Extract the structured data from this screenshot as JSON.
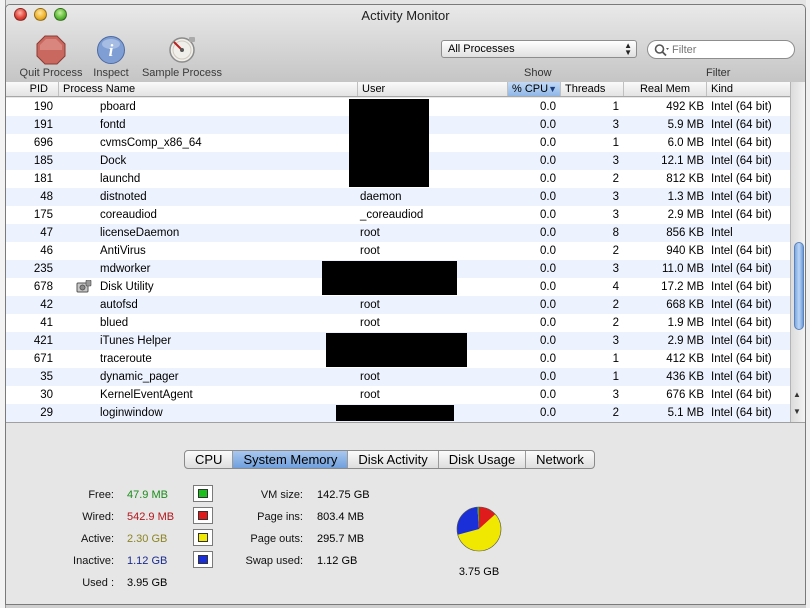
{
  "window": {
    "title": "Activity Monitor"
  },
  "toolbar": {
    "quit_label": "Quit Process",
    "inspect_label": "Inspect",
    "sample_label": "Sample Process",
    "show_value": "All Processes",
    "show_label": "Show",
    "filter_placeholder": "Filter",
    "filter_label": "Filter"
  },
  "table": {
    "columns": {
      "pid": "PID",
      "name": "Process Name",
      "user": "User",
      "cpu": "% CPU",
      "threads": "Threads",
      "mem": "Real Mem",
      "kind": "Kind"
    },
    "rows": [
      {
        "pid": "190",
        "name": "pboard",
        "user": "",
        "cpu": "0.0",
        "threads": "1",
        "mem": "492 KB",
        "kind": "Intel (64 bit)"
      },
      {
        "pid": "191",
        "name": "fontd",
        "user": "",
        "cpu": "0.0",
        "threads": "3",
        "mem": "5.9 MB",
        "kind": "Intel (64 bit)"
      },
      {
        "pid": "696",
        "name": "cvmsComp_x86_64",
        "user": "",
        "cpu": "0.0",
        "threads": "1",
        "mem": "6.0 MB",
        "kind": "Intel (64 bit)"
      },
      {
        "pid": "185",
        "name": "Dock",
        "user": "",
        "cpu": "0.0",
        "threads": "3",
        "mem": "12.1 MB",
        "kind": "Intel (64 bit)"
      },
      {
        "pid": "181",
        "name": "launchd",
        "user": "",
        "cpu": "0.0",
        "threads": "2",
        "mem": "812 KB",
        "kind": "Intel (64 bit)"
      },
      {
        "pid": "48",
        "name": "distnoted",
        "user": "daemon",
        "cpu": "0.0",
        "threads": "3",
        "mem": "1.3 MB",
        "kind": "Intel (64 bit)"
      },
      {
        "pid": "175",
        "name": "coreaudiod",
        "user": "_coreaudiod",
        "cpu": "0.0",
        "threads": "3",
        "mem": "2.9 MB",
        "kind": "Intel (64 bit)"
      },
      {
        "pid": "47",
        "name": "licenseDaemon",
        "user": "root",
        "cpu": "0.0",
        "threads": "8",
        "mem": "856 KB",
        "kind": "Intel"
      },
      {
        "pid": "46",
        "name": "AntiVirus",
        "user": "root",
        "cpu": "0.0",
        "threads": "2",
        "mem": "940 KB",
        "kind": "Intel (64 bit)"
      },
      {
        "pid": "235",
        "name": "mdworker",
        "user": "",
        "cpu": "0.0",
        "threads": "3",
        "mem": "11.0 MB",
        "kind": "Intel (64 bit)"
      },
      {
        "pid": "678",
        "name": "Disk Utility",
        "user": "",
        "cpu": "0.0",
        "threads": "4",
        "mem": "17.2 MB",
        "kind": "Intel (64 bit)",
        "icon": "disk-utility-icon"
      },
      {
        "pid": "42",
        "name": "autofsd",
        "user": "root",
        "cpu": "0.0",
        "threads": "2",
        "mem": "668 KB",
        "kind": "Intel (64 bit)"
      },
      {
        "pid": "41",
        "name": "blued",
        "user": "root",
        "cpu": "0.0",
        "threads": "2",
        "mem": "1.9 MB",
        "kind": "Intel (64 bit)"
      },
      {
        "pid": "421",
        "name": "iTunes Helper",
        "user": "",
        "cpu": "0.0",
        "threads": "3",
        "mem": "2.9 MB",
        "kind": "Intel (64 bit)"
      },
      {
        "pid": "671",
        "name": "traceroute",
        "user": "",
        "cpu": "0.0",
        "threads": "1",
        "mem": "412 KB",
        "kind": "Intel (64 bit)"
      },
      {
        "pid": "35",
        "name": "dynamic_pager",
        "user": "root",
        "cpu": "0.0",
        "threads": "1",
        "mem": "436 KB",
        "kind": "Intel (64 bit)"
      },
      {
        "pid": "30",
        "name": "KernelEventAgent",
        "user": "root",
        "cpu": "0.0",
        "threads": "3",
        "mem": "676 KB",
        "kind": "Intel (64 bit)"
      },
      {
        "pid": "29",
        "name": "loginwindow",
        "user": "",
        "cpu": "0.0",
        "threads": "2",
        "mem": "5.1 MB",
        "kind": "Intel (64 bit)"
      }
    ]
  },
  "tabs": [
    "CPU",
    "System Memory",
    "Disk Activity",
    "Disk Usage",
    "Network"
  ],
  "memory": {
    "free_label": "Free:",
    "free": "47.9 MB",
    "wired_label": "Wired:",
    "wired": "542.9 MB",
    "active_label": "Active:",
    "active": "2.30 GB",
    "inactive_label": "Inactive:",
    "inactive": "1.12 GB",
    "used_label": "Used :",
    "used": "3.95 GB",
    "vm_size_label": "VM size:",
    "vm_size": "142.75 GB",
    "page_ins_label": "Page ins:",
    "page_ins": "803.4 MB",
    "page_outs_label": "Page outs:",
    "page_outs": "295.7 MB",
    "swap_label": "Swap used:",
    "swap": "1.12 GB",
    "total": "3.75 GB",
    "colors": {
      "free": "#1cbf1c",
      "wired": "#e01b1b",
      "active": "#f0e800",
      "inactive": "#1a2fd8"
    },
    "text_colors": {
      "free": "#1a8c1a",
      "wired": "#b3161b",
      "active": "#8c8424",
      "inactive": "#1a2a8c"
    }
  }
}
